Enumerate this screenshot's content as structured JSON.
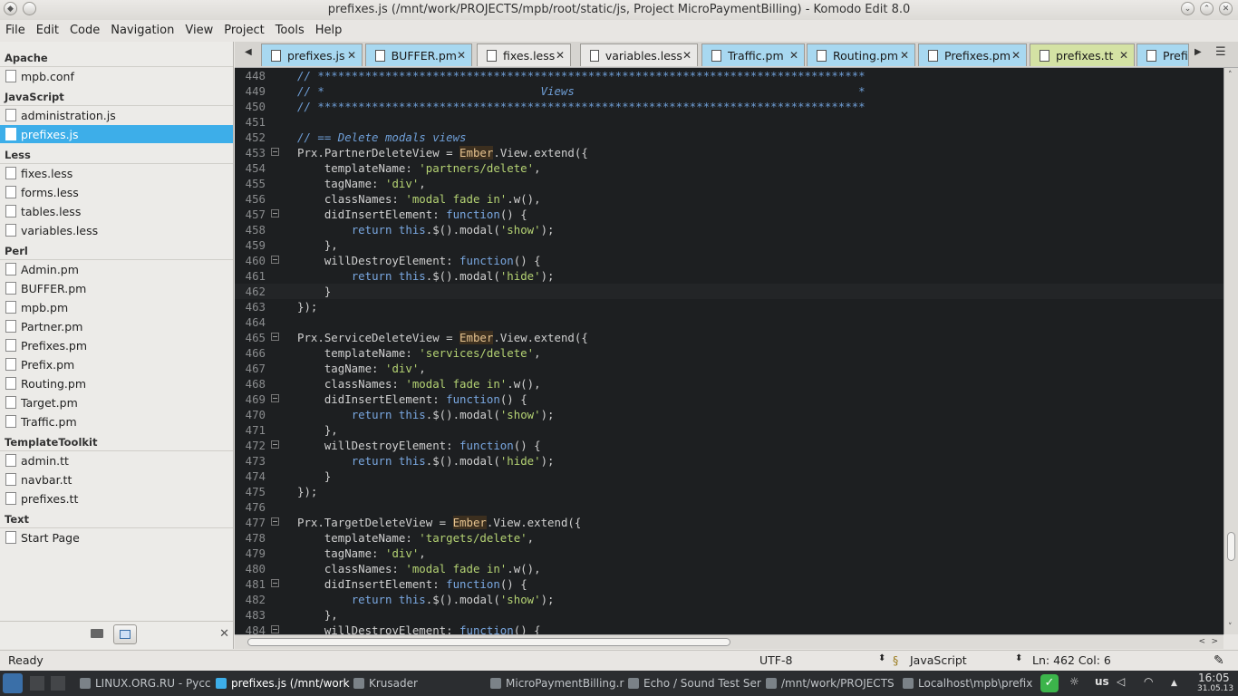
{
  "window": {
    "title": "prefixes.js (/mnt/work/PROJECTS/mpb/root/static/js, Project MicroPaymentBilling) - Komodo Edit 8.0"
  },
  "menu": [
    "File",
    "Edit",
    "Code",
    "Navigation",
    "View",
    "Project",
    "Tools",
    "Help"
  ],
  "sidebar": {
    "groups": [
      {
        "title": "Apache",
        "items": [
          "mpb.conf"
        ]
      },
      {
        "title": "JavaScript",
        "items": [
          "administration.js",
          "prefixes.js"
        ]
      },
      {
        "title": "Less",
        "items": [
          "fixes.less",
          "forms.less",
          "tables.less",
          "variables.less"
        ]
      },
      {
        "title": "Perl",
        "items": [
          "Admin.pm",
          "BUFFER.pm",
          "mpb.pm",
          "Partner.pm",
          "Prefixes.pm",
          "Prefix.pm",
          "Routing.pm",
          "Target.pm",
          "Traffic.pm"
        ]
      },
      {
        "title": "TemplateToolkit",
        "items": [
          "admin.tt",
          "navbar.tt",
          "prefixes.tt"
        ]
      },
      {
        "title": "Text",
        "items": [
          "Start Page"
        ]
      }
    ],
    "selected": "prefixes.js"
  },
  "tabs": [
    "prefixes.js",
    "BUFFER.pm",
    "fixes.less",
    "variables.less",
    "Traffic.pm",
    "Routing.pm",
    "Prefixes.pm",
    "prefixes.tt",
    "Prefi"
  ],
  "editor": {
    "lines": [
      {
        "n": "448",
        "t": "// *********************************************************************************"
      },
      {
        "n": "449",
        "t": "// *                                Views                                          *"
      },
      {
        "n": "450",
        "t": "// *********************************************************************************"
      },
      {
        "n": "451",
        "t": ""
      },
      {
        "n": "452",
        "t": "// == Delete modals views"
      },
      {
        "n": "453",
        "t": "Prx.PartnerDeleteView = Ember.View.extend({"
      },
      {
        "n": "454",
        "t": "    templateName: 'partners/delete',"
      },
      {
        "n": "455",
        "t": "    tagName: 'div',"
      },
      {
        "n": "456",
        "t": "    classNames: 'modal fade in'.w(),"
      },
      {
        "n": "457",
        "t": "    didInsertElement: function() {"
      },
      {
        "n": "458",
        "t": "        return this.$().modal('show');"
      },
      {
        "n": "459",
        "t": "    },"
      },
      {
        "n": "460",
        "t": "    willDestroyElement: function() {"
      },
      {
        "n": "461",
        "t": "        return this.$().modal('hide');"
      },
      {
        "n": "462",
        "t": "    }"
      },
      {
        "n": "463",
        "t": "});"
      },
      {
        "n": "464",
        "t": ""
      },
      {
        "n": "465",
        "t": "Prx.ServiceDeleteView = Ember.View.extend({"
      },
      {
        "n": "466",
        "t": "    templateName: 'services/delete',"
      },
      {
        "n": "467",
        "t": "    tagName: 'div',"
      },
      {
        "n": "468",
        "t": "    classNames: 'modal fade in'.w(),"
      },
      {
        "n": "469",
        "t": "    didInsertElement: function() {"
      },
      {
        "n": "470",
        "t": "        return this.$().modal('show');"
      },
      {
        "n": "471",
        "t": "    },"
      },
      {
        "n": "472",
        "t": "    willDestroyElement: function() {"
      },
      {
        "n": "473",
        "t": "        return this.$().modal('hide');"
      },
      {
        "n": "474",
        "t": "    }"
      },
      {
        "n": "475",
        "t": "});"
      },
      {
        "n": "476",
        "t": ""
      },
      {
        "n": "477",
        "t": "Prx.TargetDeleteView = Ember.View.extend({"
      },
      {
        "n": "478",
        "t": "    templateName: 'targets/delete',"
      },
      {
        "n": "479",
        "t": "    tagName: 'div',"
      },
      {
        "n": "480",
        "t": "    classNames: 'modal fade in'.w(),"
      },
      {
        "n": "481",
        "t": "    didInsertElement: function() {"
      },
      {
        "n": "482",
        "t": "        return this.$().modal('show');"
      },
      {
        "n": "483",
        "t": "    },"
      },
      {
        "n": "484",
        "t": "    willDestroyElement: function() {"
      }
    ]
  },
  "status": {
    "state": "Ready",
    "encoding": "UTF-8",
    "language": "JavaScript",
    "position": "Ln: 462 Col: 6"
  },
  "taskbar": {
    "tasks": [
      "LINUX.ORG.RU - Русс",
      "prefixes.js (/mnt/work",
      "Krusader",
      "MicroPaymentBilling.r",
      "Echo / Sound Test Ser",
      "/mnt/work/PROJECTS",
      "Localhost\\mpb\\prefix"
    ],
    "layout": "us",
    "time": "16:05",
    "date": "31.05.13"
  },
  "colors": {
    "selection": "#3daee9",
    "editor_bg": "#1d1f21",
    "comment": "#6f9fd8",
    "string": "#b4d273"
  }
}
